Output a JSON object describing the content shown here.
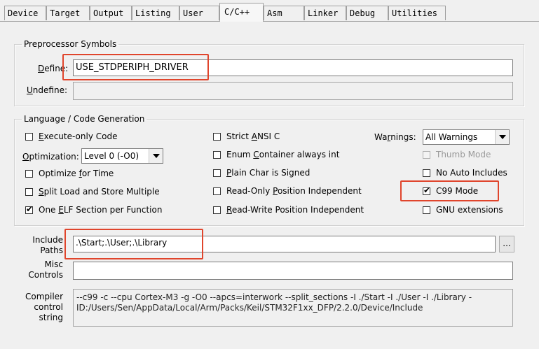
{
  "tabs": [
    {
      "label": "Device"
    },
    {
      "label": "Target"
    },
    {
      "label": "Output"
    },
    {
      "label": "Listing"
    },
    {
      "label": "User"
    },
    {
      "label": "C/C++"
    },
    {
      "label": "Asm"
    },
    {
      "label": "Linker"
    },
    {
      "label": "Debug"
    },
    {
      "label": "Utilities"
    }
  ],
  "preprocessor": {
    "legend": "Preprocessor Symbols",
    "define_label_prefix": "",
    "define_label_hotkey": "D",
    "define_label_rest": "efine:",
    "define_value": "USE_STDPERIPH_DRIVER",
    "undefine_label_hotkey": "U",
    "undefine_label_rest": "ndefine:",
    "undefine_value": ""
  },
  "language": {
    "legend": "Language / Code Generation",
    "execute_only": {
      "pre": "E",
      "rest": "xecute-only Code",
      "checked": false
    },
    "optimization_label_hotkey": "O",
    "optimization_label_rest": "ptimization:",
    "optimization_value": "Level 0 (-O0)",
    "optimize_time": {
      "pre": "Optimize ",
      "hot": "f",
      "rest": "or Time",
      "checked": false
    },
    "split_load": {
      "hot": "S",
      "rest": "plit Load and Store Multiple",
      "checked": false
    },
    "one_elf": {
      "pre": "One ",
      "hot": "E",
      "rest": "LF Section per Function",
      "checked": true
    },
    "strict_ansi": {
      "pre": "Strict ",
      "hot": "A",
      "rest": "NSI C",
      "checked": false
    },
    "enum_container": {
      "pre": "Enum ",
      "hot": "C",
      "rest": "ontainer always int",
      "checked": false
    },
    "plain_char": {
      "hot": "P",
      "rest": "lain Char is Signed",
      "checked": false
    },
    "ro_pi": {
      "pre": "Read-Only ",
      "hot": "P",
      "rest": "osition Independent",
      "checked": false
    },
    "rw_pi": {
      "hot": "R",
      "rest": "ead-Write Position Independent",
      "checked": false
    },
    "warnings_label_pre": "Wa",
    "warnings_label_hot": "r",
    "warnings_label_rest": "nings:",
    "warnings_value": "All Warnings",
    "thumb_mode": {
      "label": "Thumb Mode",
      "checked": false,
      "disabled": true
    },
    "no_auto_includes": {
      "label": "No Auto Includes",
      "checked": false
    },
    "c99_mode": {
      "label": "C99 Mode",
      "checked": true
    },
    "gnu_extensions": {
      "label": "GNU extensions",
      "checked": false
    }
  },
  "include_paths": {
    "label_line1": "Include",
    "label_line2": "Paths",
    "value": ".\\Start;.\\User;.\\Library",
    "browse_label": "..."
  },
  "misc_controls": {
    "label_line1": "Misc",
    "label_line2": "Controls",
    "value": ""
  },
  "compiler_control": {
    "label_line1": "Compiler",
    "label_line2": "control",
    "label_line3": "string",
    "value": "--c99 -c --cpu Cortex-M3 -g -O0 --apcs=interwork --split_sections -I ./Start -I ./User -I ./Library -ID:/Users/Sen/AppData/Local/Arm/Packs/Keil/STM32F1xx_DFP/2.2.0/Device/Include"
  },
  "colors": {
    "highlight": "#e0452c",
    "background": "#f0f0f0"
  }
}
